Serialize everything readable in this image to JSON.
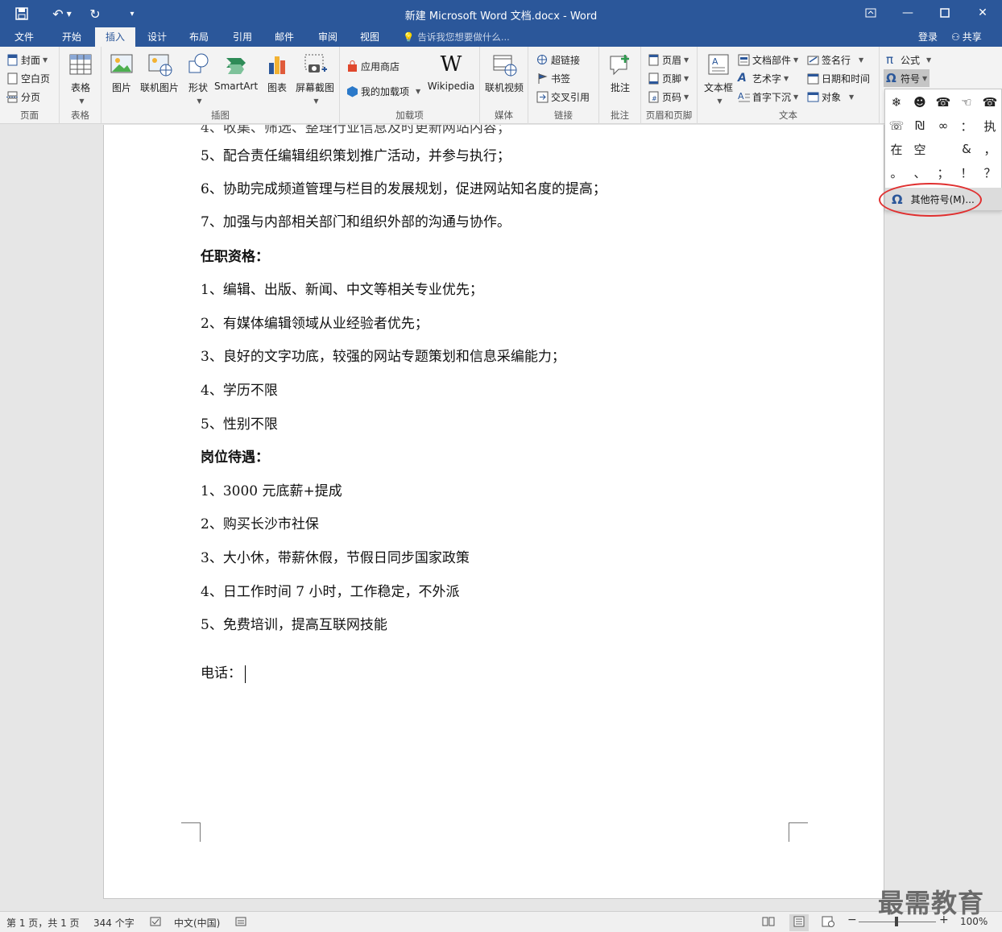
{
  "window": {
    "title": "新建 Microsoft Word 文档.docx - Word"
  },
  "tabs": [
    "文件",
    "开始",
    "插入",
    "设计",
    "布局",
    "引用",
    "邮件",
    "审阅",
    "视图"
  ],
  "active_tab": "插入",
  "tellme": "告诉我您想要做什么...",
  "account": {
    "login": "登录",
    "share": "共享"
  },
  "ribbon": {
    "pages": {
      "label": "页面",
      "cover": "封面",
      "blank": "空白页",
      "break": "分页"
    },
    "tables": {
      "label": "表格",
      "table": "表格"
    },
    "illustrations": {
      "label": "插图",
      "picture": "图片",
      "online_picture": "联机图片",
      "shapes": "形状",
      "smartart": "SmartArt",
      "chart": "图表",
      "screenshot": "屏幕截图"
    },
    "addins": {
      "label": "加载项",
      "store": "应用商店",
      "my_addins": "我的加载项",
      "wikipedia": "Wikipedia"
    },
    "media": {
      "label": "媒体",
      "online_video": "联机视频"
    },
    "links": {
      "label": "链接",
      "hyperlink": "超链接",
      "bookmark": "书签",
      "crossref": "交叉引用"
    },
    "comments": {
      "label": "批注",
      "comment": "批注"
    },
    "header_footer": {
      "label": "页眉和页脚",
      "header": "页眉",
      "footer": "页脚",
      "page_number": "页码"
    },
    "text": {
      "label": "文本",
      "textbox": "文本框",
      "quick_parts": "文档部件",
      "wordart": "艺术字",
      "dropcap": "首字下沉",
      "signature": "签名行",
      "datetime": "日期和时间",
      "object": "对象"
    },
    "symbols": {
      "equation": "公式",
      "symbol": "符号"
    }
  },
  "symbol_menu": {
    "symbols": [
      "❄",
      "☻",
      "☎",
      "☜",
      "☎",
      "☏",
      "₪",
      "∞",
      "：",
      "执",
      "在",
      "空",
      "",
      "&",
      "，",
      "。",
      "、",
      "；",
      "！",
      "？"
    ],
    "more": "其他符号(M)..."
  },
  "document": {
    "lines": [
      "5、配合责任编辑组织策划推广活动，并参与执行；",
      "6、协助完成频道管理与栏目的发展规划，促进网站知名度的提高；",
      "7、加强与内部相关部门和组织外部的沟通与协作。",
      "任职资格：",
      "1、编辑、出版、新闻、中文等相关专业优先；",
      "2、有媒体编辑领域从业经验者优先；",
      "3、良好的文字功底，较强的网站专题策划和信息采编能力；",
      "4、学历不限",
      "5、性别不限",
      "岗位待遇：",
      "1、3000 元底薪+提成",
      "2、购买长沙市社保",
      "3、大小休，带薪休假，节假日同步国家政策",
      "4、日工作时间 7 小时，工作稳定，不外派",
      "5、免费培训，提高互联网技能",
      "电话："
    ]
  },
  "status": {
    "page": "第 1 页，共 1 页",
    "words": "344 个字",
    "language": "中文(中国)",
    "zoom": "100%"
  },
  "watermark": "最需教育",
  "colors": {
    "accent": "#2b579a",
    "highlight": "#e03030"
  }
}
